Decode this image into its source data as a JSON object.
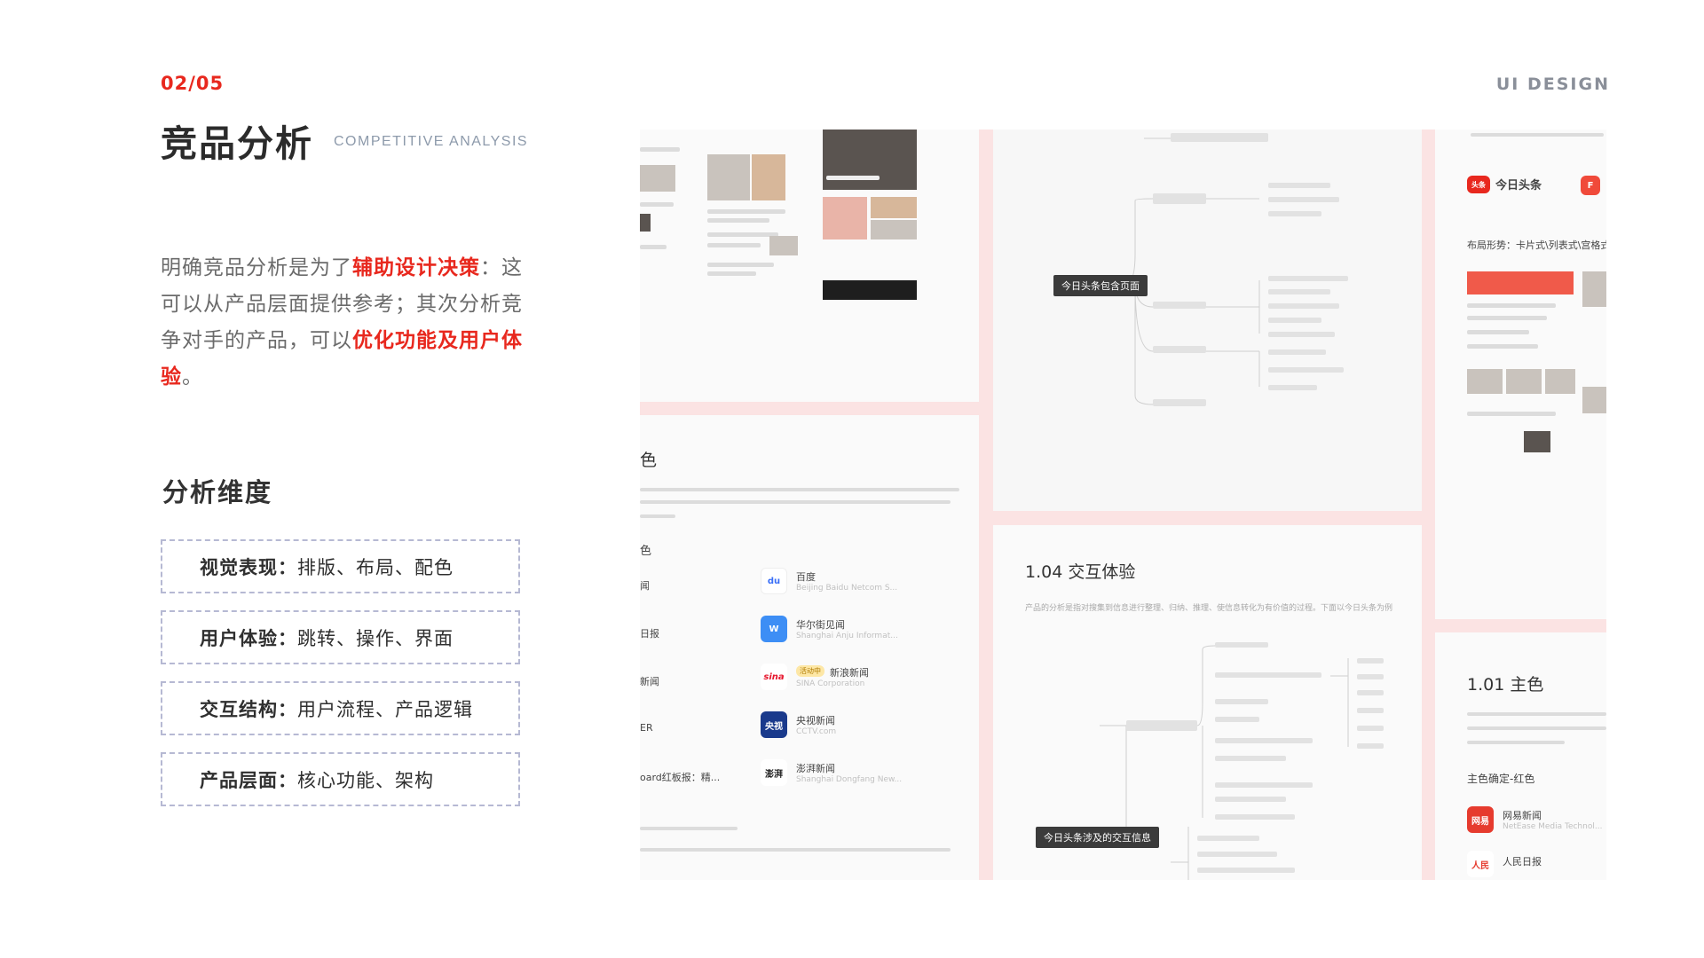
{
  "header": {
    "page_number": "02/05",
    "tag": "UI DESIGN",
    "title": "竞品分析",
    "subtitle": "COMPETITIVE ANALYSIS"
  },
  "intro": {
    "part1": "明确竞品分析是为了",
    "highlight1": "辅助设计决策",
    "part2": "：这可以从产品层面提供参考；其次分析竞争对手的产品，可以",
    "highlight2": "优化功能及用户体验",
    "part3": "。"
  },
  "dimensions": {
    "title": "分析维度",
    "items": [
      {
        "key": "视觉表现：",
        "value": "排版、布局、配色"
      },
      {
        "key": "用户体验：",
        "value": "跳转、操作、界面"
      },
      {
        "key": "交互结构：",
        "value": "用户流程、产品逻辑"
      },
      {
        "key": "产品层面：",
        "value": "核心功能、架构"
      }
    ]
  },
  "collage": {
    "mindmap_root": "今日头条包含页面",
    "color_section_title": "色",
    "color_sub": "色",
    "apps_left": [
      "闻",
      "日报",
      "新闻",
      "ER",
      "oard红板报：精..."
    ],
    "apps_right": [
      {
        "name": "百度",
        "sub": "Beijing Baidu Netcom S..."
      },
      {
        "name": "华尔街见闻",
        "sub": "Shanghai Anju Informat..."
      },
      {
        "name": "新浪新闻",
        "sub": "SINA Corporation",
        "badge": "活动中"
      },
      {
        "name": "央视新闻",
        "sub": "CCTV.com"
      },
      {
        "name": "澎湃新闻",
        "sub": "Shanghai Dongfang New..."
      }
    ],
    "interaction_title": "1.04  交互体验",
    "interaction_desc": "产品的分析是指对搜集到信息进行整理、归纳、推理、使信息转化为有价值的过程。下面以今日头条为例",
    "interaction_node": "今日头条涉及的交互信息",
    "toutiao_label": "今日头条",
    "layout_label": "布局形势：卡片式\\列表式\\宫格式",
    "main_color_title": "1.01  主色",
    "main_color_label": "主色确定-红色",
    "apps_bottom": [
      {
        "name": "网易新闻",
        "sub": "NetEase Media Technol..."
      },
      {
        "name": "人民日报",
        "sub": ""
      }
    ],
    "colors": {
      "baidu": "#3a6ff7",
      "wallstreet": "#3d8ef5",
      "sina": "#e6162d",
      "cctv": "#1a3a8c",
      "netease": "#e63b2e",
      "accent": "#e8281e"
    }
  }
}
